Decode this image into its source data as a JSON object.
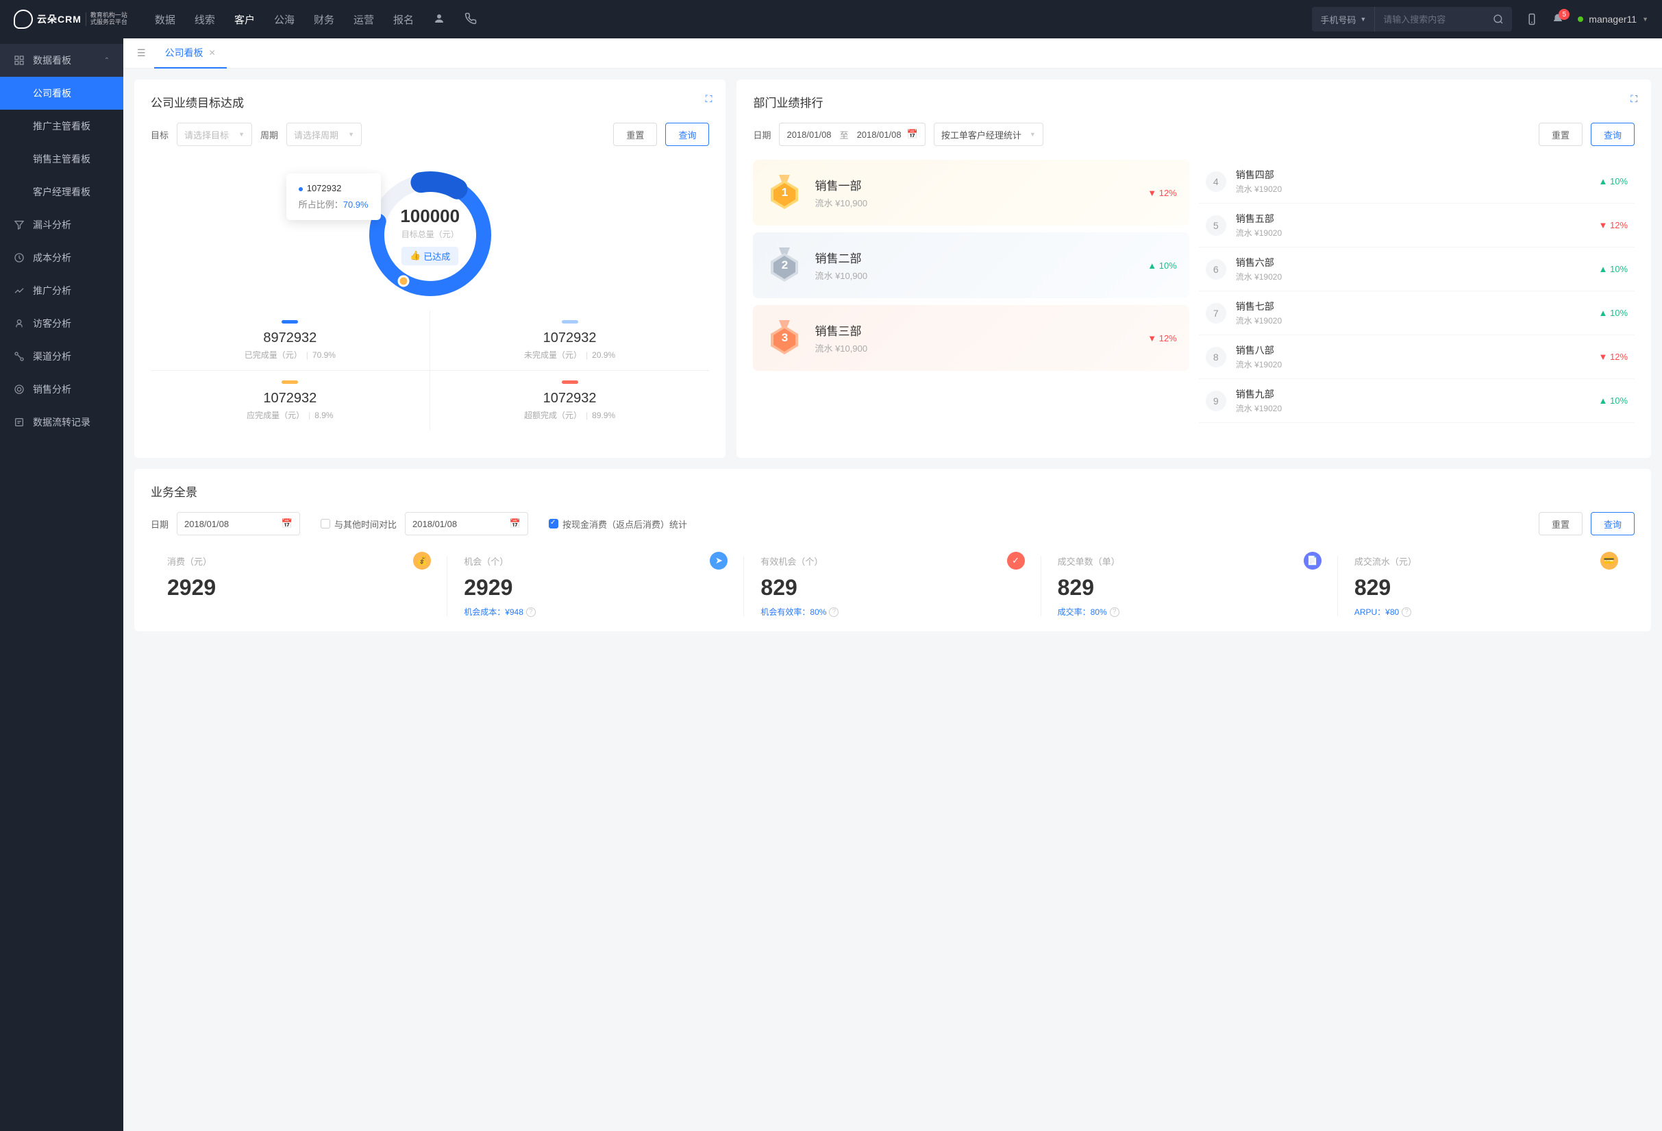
{
  "topnav": {
    "logo_main": "云朵CRM",
    "logo_sub": "教育机构一站\n式服务云平台",
    "menu": [
      "数据",
      "线索",
      "客户",
      "公海",
      "财务",
      "运营",
      "报名"
    ],
    "active_idx": 2,
    "search_type": "手机号码",
    "search_placeholder": "请输入搜索内容",
    "notif_count": "5",
    "username": "manager11"
  },
  "sidebar": {
    "group_title": "数据看板",
    "group_items": [
      "公司看板",
      "推广主管看板",
      "销售主管看板",
      "客户经理看板"
    ],
    "group_active": 0,
    "items": [
      "漏斗分析",
      "成本分析",
      "推广分析",
      "访客分析",
      "渠道分析",
      "销售分析",
      "数据流转记录"
    ]
  },
  "tab": {
    "title": "公司看板"
  },
  "target_card": {
    "title": "公司业绩目标达成",
    "filter": {
      "goal_label": "目标",
      "goal_placeholder": "请选择目标",
      "period_label": "周期",
      "period_placeholder": "请选择周期"
    },
    "reset": "重置",
    "query": "查询",
    "donut": {
      "center_val": "100000",
      "center_lbl": "目标总量（元）",
      "badge": "已达成",
      "tooltip_val": "1072932",
      "tooltip_lbl": "所占比例：",
      "tooltip_pct": "70.9%"
    },
    "stats": [
      {
        "color": "#2879ff",
        "val": "8972932",
        "lbl": "已完成量（元）",
        "pct": "70.9%"
      },
      {
        "color": "#a8ccff",
        "val": "1072932",
        "lbl": "未完成量（元）",
        "pct": "20.9%"
      },
      {
        "color": "#ffb84d",
        "val": "1072932",
        "lbl": "应完成量（元）",
        "pct": "8.9%"
      },
      {
        "color": "#ff6b5b",
        "val": "1072932",
        "lbl": "超额完成（元）",
        "pct": "89.9%"
      }
    ]
  },
  "rank_card": {
    "title": "部门业绩排行",
    "filter": {
      "date_label": "日期",
      "date_from": "2018/01/08",
      "date_to_lbl": "至",
      "date_to": "2018/01/08",
      "mode": "按工单客户经理统计"
    },
    "reset": "重置",
    "query": "查询",
    "top3": [
      {
        "rank": "1",
        "name": "销售一部",
        "amt": "流水 ¥10,900",
        "pct": "12%",
        "dir": "down",
        "medal": "gold"
      },
      {
        "rank": "2",
        "name": "销售二部",
        "amt": "流水 ¥10,900",
        "pct": "10%",
        "dir": "up",
        "medal": "silver"
      },
      {
        "rank": "3",
        "name": "销售三部",
        "amt": "流水 ¥10,900",
        "pct": "12%",
        "dir": "down",
        "medal": "bronze"
      }
    ],
    "rest": [
      {
        "rank": "4",
        "name": "销售四部",
        "amt": "流水 ¥19020",
        "pct": "10%",
        "dir": "up"
      },
      {
        "rank": "5",
        "name": "销售五部",
        "amt": "流水 ¥19020",
        "pct": "12%",
        "dir": "down"
      },
      {
        "rank": "6",
        "name": "销售六部",
        "amt": "流水 ¥19020",
        "pct": "10%",
        "dir": "up"
      },
      {
        "rank": "7",
        "name": "销售七部",
        "amt": "流水 ¥19020",
        "pct": "10%",
        "dir": "up"
      },
      {
        "rank": "8",
        "name": "销售八部",
        "amt": "流水 ¥19020",
        "pct": "12%",
        "dir": "down"
      },
      {
        "rank": "9",
        "name": "销售九部",
        "amt": "流水 ¥19020",
        "pct": "10%",
        "dir": "up"
      }
    ]
  },
  "biz_card": {
    "title": "业务全景",
    "filter": {
      "date_label": "日期",
      "date": "2018/01/08",
      "compare_label": "与其他时间对比",
      "date2": "2018/01/08",
      "checkbox_label": "按现金消费（返点后消费）统计"
    },
    "reset": "重置",
    "query": "查询",
    "metrics": [
      {
        "lbl": "消费（元）",
        "icon_color": "#ffb84d",
        "icon_glyph": "💰",
        "val": "2929",
        "sub": ""
      },
      {
        "lbl": "机会（个）",
        "icon_color": "#4a9eff",
        "icon_glyph": "➤",
        "val": "2929",
        "sub": "机会成本：¥948"
      },
      {
        "lbl": "有效机会（个）",
        "icon_color": "#ff6b5b",
        "icon_glyph": "✓",
        "val": "829",
        "sub": "机会有效率：80%"
      },
      {
        "lbl": "成交单数（单）",
        "icon_color": "#6a7bff",
        "icon_glyph": "📄",
        "val": "829",
        "sub": "成交率：80%"
      },
      {
        "lbl": "成交流水（元）",
        "icon_color": "#ffb84d",
        "icon_glyph": "💳",
        "val": "829",
        "sub": "ARPU：¥80"
      }
    ]
  },
  "chart_data": {
    "type": "pie",
    "title": "公司业绩目标达成",
    "total_label": "目标总量（元）",
    "total_value": 100000,
    "status": "已达成",
    "series": [
      {
        "name": "已完成量（元）",
        "value": 8972932,
        "pct": 70.9,
        "color": "#2879ff"
      },
      {
        "name": "未完成量（元）",
        "value": 1072932,
        "pct": 20.9,
        "color": "#a8ccff"
      },
      {
        "name": "应完成量（元）",
        "value": 1072932,
        "pct": 8.9,
        "color": "#ffb84d"
      },
      {
        "name": "超额完成（元）",
        "value": 1072932,
        "pct": 89.9,
        "color": "#ff6b5b"
      }
    ],
    "tooltip": {
      "value": 1072932,
      "pct": 70.9
    }
  }
}
